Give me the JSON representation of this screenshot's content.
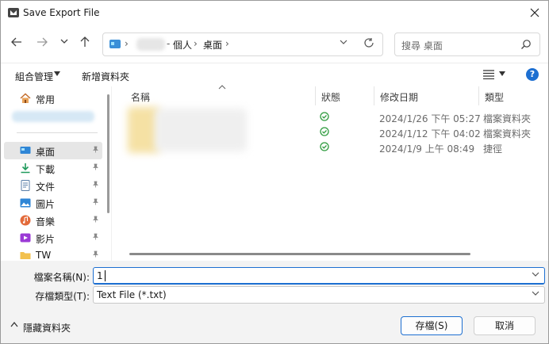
{
  "window": {
    "title": "Save Export File"
  },
  "address": {
    "segments": [
      "個人",
      "桌面"
    ],
    "separator_1": "›",
    "separator_2": "-",
    "separator_3": "›",
    "separator_4": "›"
  },
  "search": {
    "placeholder": "搜尋 桌面"
  },
  "toolbar": {
    "organize_label": "組合管理",
    "new_folder_label": "新增資料夾"
  },
  "sidebar": {
    "quick_access_label": "常用",
    "items": [
      {
        "label": "桌面",
        "icon": "desktop-icon",
        "selected": true
      },
      {
        "label": "下載",
        "icon": "download-icon"
      },
      {
        "label": "文件",
        "icon": "document-icon"
      },
      {
        "label": "圖片",
        "icon": "picture-icon"
      },
      {
        "label": "音樂",
        "icon": "music-icon"
      },
      {
        "label": "影片",
        "icon": "video-icon"
      },
      {
        "label": "TW",
        "icon": "folder-icon"
      }
    ]
  },
  "filelist": {
    "columns": [
      "名稱",
      "狀態",
      "修改日期",
      "類型"
    ],
    "rows": [
      {
        "date": "2024/1/26 下午 05:27",
        "type": "檔案資料夾"
      },
      {
        "date": "2024/1/12 下午 04:02",
        "type": "檔案資料夾"
      },
      {
        "date": "2024/1/9 上午 08:49",
        "type": "捷徑"
      }
    ]
  },
  "form": {
    "filename_label": "檔案名稱(N):",
    "filename_value": "1",
    "filetype_label": "存檔類型(T):",
    "filetype_value": "Text File (*.txt)"
  },
  "footer": {
    "hide_folders_label": "隱藏資料夾",
    "save_label": "存檔(S)",
    "cancel_label": "取消"
  },
  "colors": {
    "accent": "#1d6fd1",
    "status_ok": "#2e9b3e"
  }
}
